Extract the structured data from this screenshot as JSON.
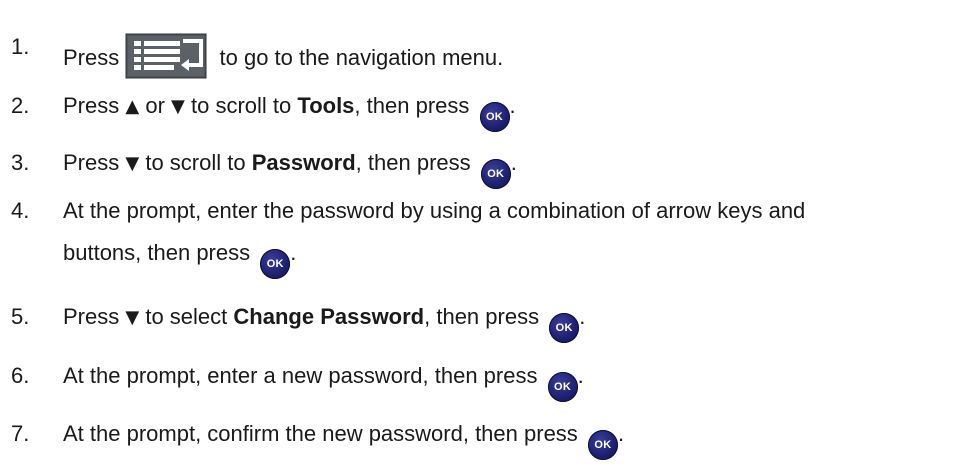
{
  "steps": [
    {
      "num": "1.",
      "press": "Press",
      "rest": "to go to the navigation menu."
    },
    {
      "num": "2.",
      "press": "Press",
      "up": "▲",
      "or": "or",
      "down": "▼",
      "mid": "to scroll to",
      "bold": "Tools",
      "after": ", then press",
      "ok": "OK",
      "end": "."
    },
    {
      "num": "3.",
      "press": "Press",
      "down": "▼",
      "mid": "to scroll to",
      "bold": "Password",
      "after": ", then press",
      "ok": "OK",
      "end": "."
    },
    {
      "num": "4.",
      "line1": "At the prompt, enter the password by using a combination of arrow keys and",
      "line2": "buttons, then press",
      "ok": "OK",
      "end": "."
    },
    {
      "num": "5.",
      "press": "Press",
      "down": "▼",
      "mid": "to select",
      "bold": "Change Password",
      "after": ", then press",
      "ok": "OK",
      "end": "."
    },
    {
      "num": "6.",
      "text": "At the prompt, enter a new password, then press",
      "ok": "OK",
      "end": "."
    },
    {
      "num": "7.",
      "text": "At the prompt, confirm the new password, then press",
      "ok": "OK",
      "end": "."
    }
  ],
  "icons": {
    "nav_menu_button": "navigation-menu-icon",
    "ok_button": "ok-button-icon"
  },
  "colors": {
    "ok_button": "#1c1f6e",
    "nav_icon_bg": "#4a4f55"
  }
}
